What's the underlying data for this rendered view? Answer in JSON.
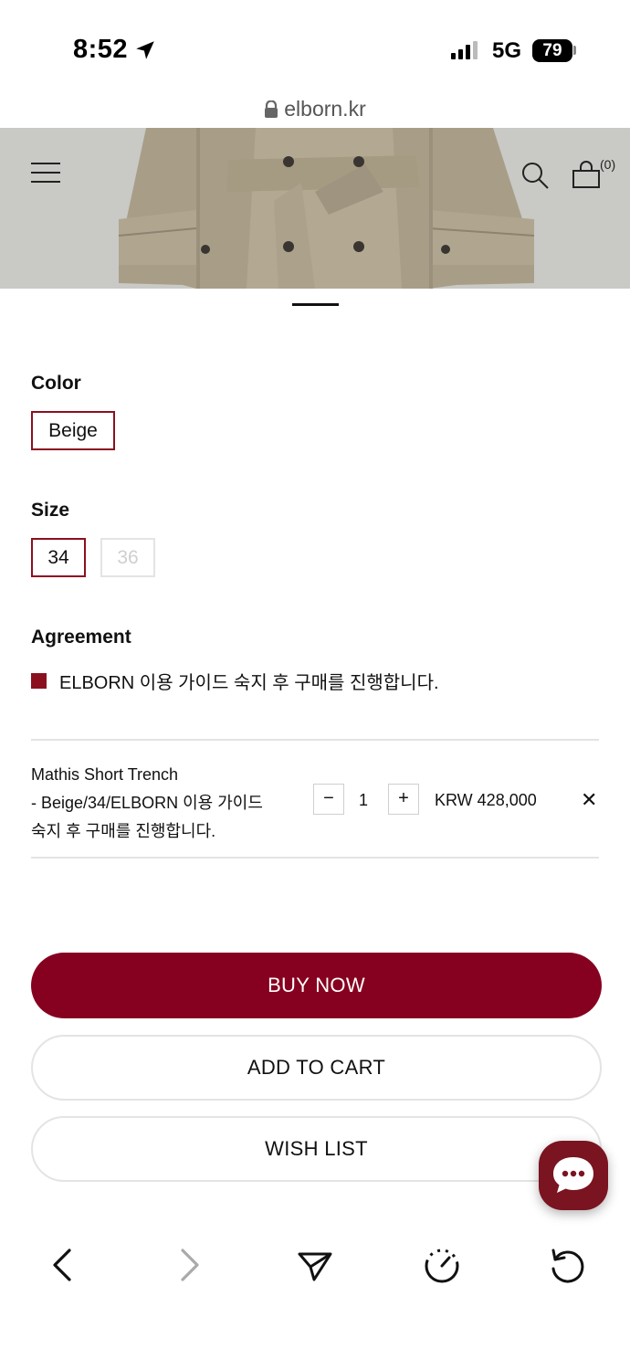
{
  "status": {
    "time": "8:52",
    "network": "5G",
    "battery": "79"
  },
  "browser": {
    "url": "elborn.kr"
  },
  "header": {
    "cart_count": "(0)"
  },
  "product": {
    "color_label": "Color",
    "colors": [
      "Beige"
    ],
    "size_label": "Size",
    "sizes": [
      "34",
      "36"
    ],
    "agreement_label": "Agreement",
    "agreement_text": "ELBORN 이용 가이드 숙지 후 구매를 진행합니다."
  },
  "selection": {
    "line1": "Mathis Short Trench",
    "line2": "- Beige/34/ELBORN 이용 가이드",
    "line3": "숙지 후 구매를 진행합니다.",
    "minus": "−",
    "quantity": "1",
    "plus": "+",
    "price": "KRW 428,000",
    "remove": "✕"
  },
  "actions": {
    "buy_now": "BUY NOW",
    "add_to_cart": "ADD TO CART",
    "wish_list": "WISH LIST"
  },
  "colors": {
    "accent": "#86001f",
    "chat": "#7a1420",
    "hero_bg": "#c9c9c6"
  }
}
